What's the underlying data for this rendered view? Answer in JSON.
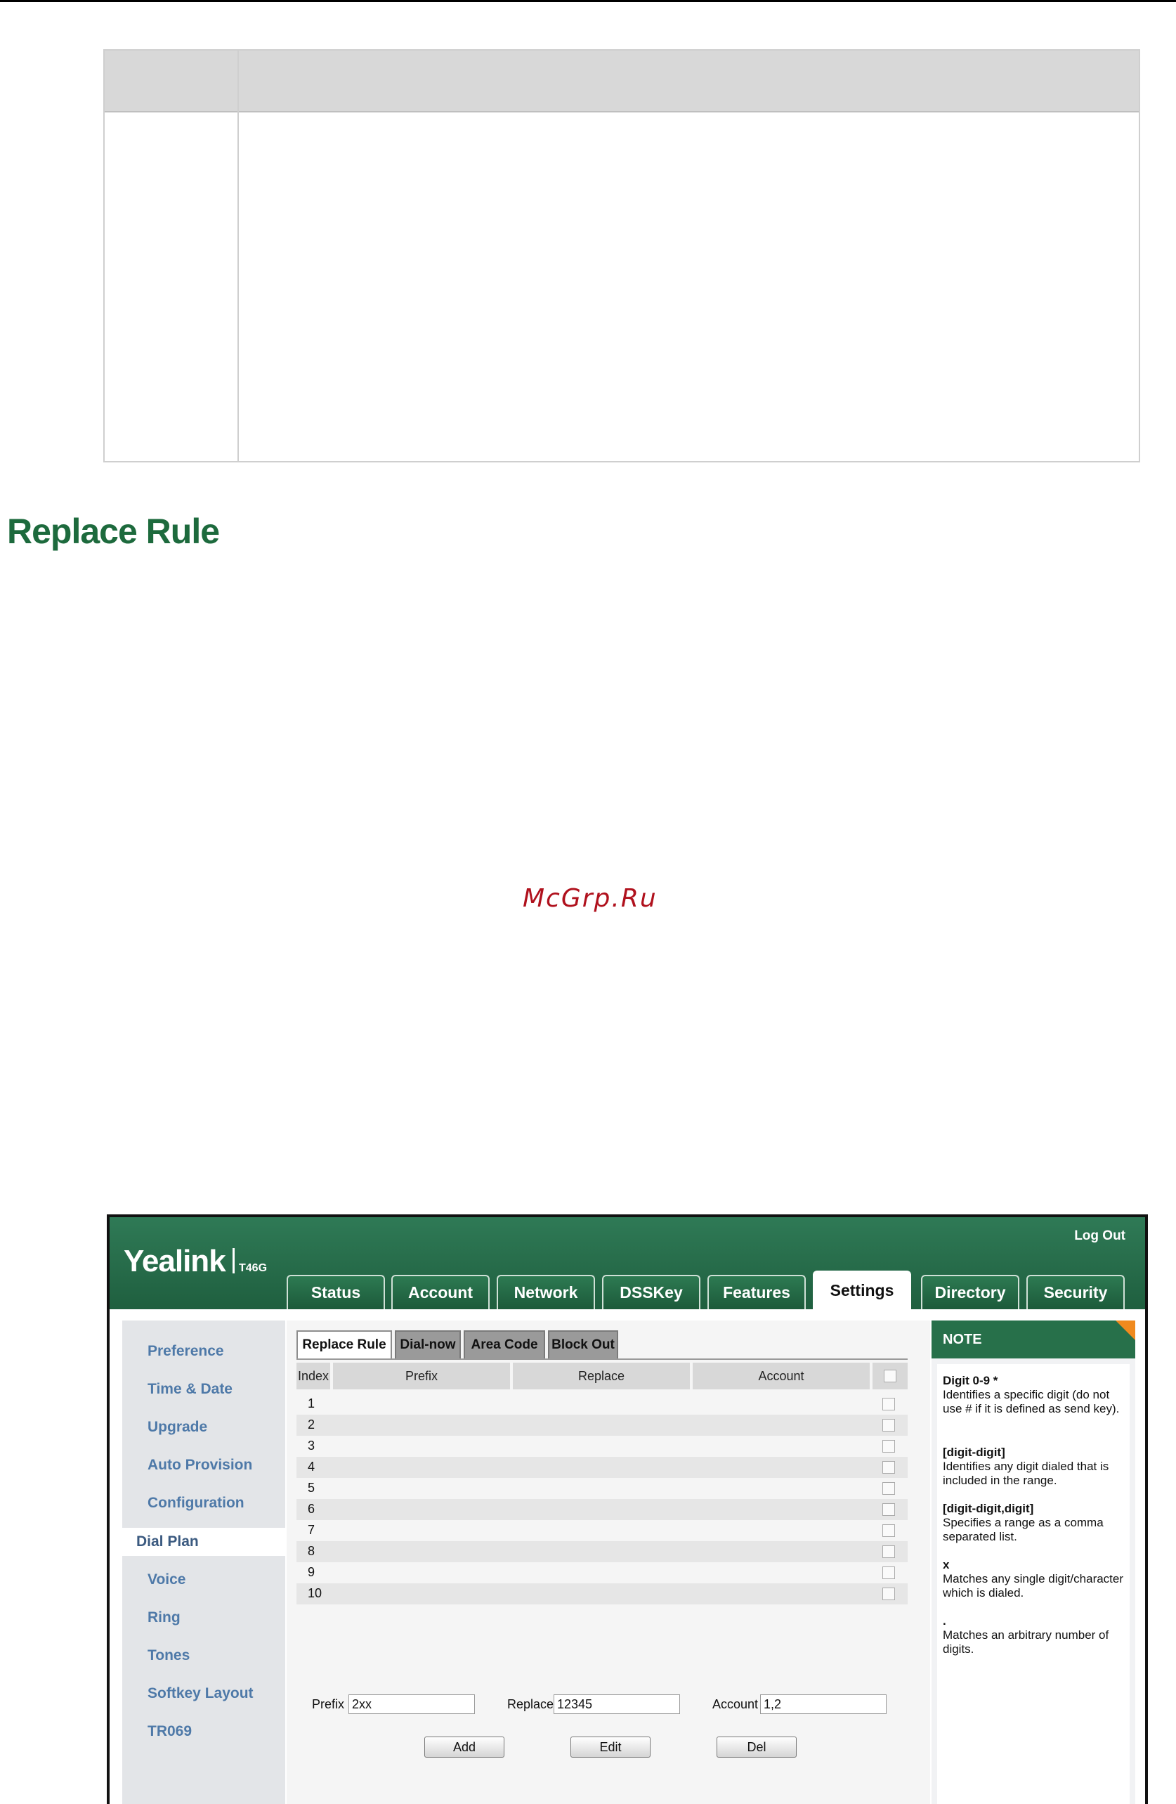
{
  "document": {
    "section_title": "Replace Rule",
    "watermark": "McGrp.Ru"
  },
  "app": {
    "logo": "Yealink",
    "model": "T46G",
    "logout_label": "Log Out",
    "nav_tabs": [
      "Status",
      "Account",
      "Network",
      "DSSKey",
      "Features",
      "Settings",
      "Directory",
      "Security"
    ],
    "active_nav": "Settings",
    "sidebar": [
      "Preference",
      "Time & Date",
      "Upgrade",
      "Auto Provision",
      "Configuration",
      "Dial Plan",
      "Voice",
      "Ring",
      "Tones",
      "Softkey Layout",
      "TR069"
    ],
    "active_sidebar": "Dial Plan",
    "sub_tabs": [
      "Replace Rule",
      "Dial-now",
      "Area Code",
      "Block Out"
    ],
    "active_sub_tab": "Replace Rule",
    "table": {
      "columns": [
        "Index",
        "Prefix",
        "Replace",
        "Account"
      ],
      "rows": [
        "1",
        "2",
        "3",
        "4",
        "5",
        "6",
        "7",
        "8",
        "9",
        "10"
      ]
    },
    "form": {
      "prefix_label": "Prefix",
      "prefix_value": "2xx",
      "replace_label": "Replace",
      "replace_value": "12345",
      "account_label": "Account",
      "account_value": "1,2"
    },
    "buttons": [
      "Add",
      "Edit",
      "Del"
    ],
    "note": {
      "title": "NOTE",
      "entries": [
        {
          "term": "Digit 0-9 *",
          "desc": "Identifies a specific digit (do not use # if it is defined as send key)."
        },
        {
          "term": "[digit-digit]",
          "desc": "Identifies any digit dialed that is included in the range."
        },
        {
          "term": "[digit-digit,digit]",
          "desc": "Specifies a range as a comma separated list."
        },
        {
          "term": "x",
          "desc": "Matches any single digit/character which is dialed."
        },
        {
          "term": ".",
          "desc": "Matches an arbitrary number of digits."
        }
      ]
    }
  },
  "colors": {
    "header_green": "#1f5f3f",
    "title_green": "#1d6a3d",
    "sidebar_link": "#4e79a8",
    "note_corner": "#f08a1e",
    "watermark": "#b0111d"
  }
}
